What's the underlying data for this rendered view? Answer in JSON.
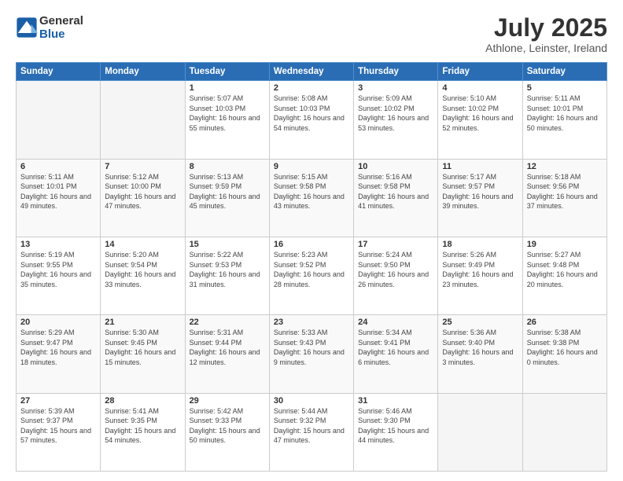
{
  "header": {
    "logo_general": "General",
    "logo_blue": "Blue",
    "month_year": "July 2025",
    "location": "Athlone, Leinster, Ireland"
  },
  "days_of_week": [
    "Sunday",
    "Monday",
    "Tuesday",
    "Wednesday",
    "Thursday",
    "Friday",
    "Saturday"
  ],
  "weeks": [
    [
      {
        "day": "",
        "empty": true
      },
      {
        "day": "",
        "empty": true
      },
      {
        "day": "1",
        "sunrise": "Sunrise: 5:07 AM",
        "sunset": "Sunset: 10:03 PM",
        "daylight": "Daylight: 16 hours and 55 minutes."
      },
      {
        "day": "2",
        "sunrise": "Sunrise: 5:08 AM",
        "sunset": "Sunset: 10:03 PM",
        "daylight": "Daylight: 16 hours and 54 minutes."
      },
      {
        "day": "3",
        "sunrise": "Sunrise: 5:09 AM",
        "sunset": "Sunset: 10:02 PM",
        "daylight": "Daylight: 16 hours and 53 minutes."
      },
      {
        "day": "4",
        "sunrise": "Sunrise: 5:10 AM",
        "sunset": "Sunset: 10:02 PM",
        "daylight": "Daylight: 16 hours and 52 minutes."
      },
      {
        "day": "5",
        "sunrise": "Sunrise: 5:11 AM",
        "sunset": "Sunset: 10:01 PM",
        "daylight": "Daylight: 16 hours and 50 minutes."
      }
    ],
    [
      {
        "day": "6",
        "sunrise": "Sunrise: 5:11 AM",
        "sunset": "Sunset: 10:01 PM",
        "daylight": "Daylight: 16 hours and 49 minutes."
      },
      {
        "day": "7",
        "sunrise": "Sunrise: 5:12 AM",
        "sunset": "Sunset: 10:00 PM",
        "daylight": "Daylight: 16 hours and 47 minutes."
      },
      {
        "day": "8",
        "sunrise": "Sunrise: 5:13 AM",
        "sunset": "Sunset: 9:59 PM",
        "daylight": "Daylight: 16 hours and 45 minutes."
      },
      {
        "day": "9",
        "sunrise": "Sunrise: 5:15 AM",
        "sunset": "Sunset: 9:58 PM",
        "daylight": "Daylight: 16 hours and 43 minutes."
      },
      {
        "day": "10",
        "sunrise": "Sunrise: 5:16 AM",
        "sunset": "Sunset: 9:58 PM",
        "daylight": "Daylight: 16 hours and 41 minutes."
      },
      {
        "day": "11",
        "sunrise": "Sunrise: 5:17 AM",
        "sunset": "Sunset: 9:57 PM",
        "daylight": "Daylight: 16 hours and 39 minutes."
      },
      {
        "day": "12",
        "sunrise": "Sunrise: 5:18 AM",
        "sunset": "Sunset: 9:56 PM",
        "daylight": "Daylight: 16 hours and 37 minutes."
      }
    ],
    [
      {
        "day": "13",
        "sunrise": "Sunrise: 5:19 AM",
        "sunset": "Sunset: 9:55 PM",
        "daylight": "Daylight: 16 hours and 35 minutes."
      },
      {
        "day": "14",
        "sunrise": "Sunrise: 5:20 AM",
        "sunset": "Sunset: 9:54 PM",
        "daylight": "Daylight: 16 hours and 33 minutes."
      },
      {
        "day": "15",
        "sunrise": "Sunrise: 5:22 AM",
        "sunset": "Sunset: 9:53 PM",
        "daylight": "Daylight: 16 hours and 31 minutes."
      },
      {
        "day": "16",
        "sunrise": "Sunrise: 5:23 AM",
        "sunset": "Sunset: 9:52 PM",
        "daylight": "Daylight: 16 hours and 28 minutes."
      },
      {
        "day": "17",
        "sunrise": "Sunrise: 5:24 AM",
        "sunset": "Sunset: 9:50 PM",
        "daylight": "Daylight: 16 hours and 26 minutes."
      },
      {
        "day": "18",
        "sunrise": "Sunrise: 5:26 AM",
        "sunset": "Sunset: 9:49 PM",
        "daylight": "Daylight: 16 hours and 23 minutes."
      },
      {
        "day": "19",
        "sunrise": "Sunrise: 5:27 AM",
        "sunset": "Sunset: 9:48 PM",
        "daylight": "Daylight: 16 hours and 20 minutes."
      }
    ],
    [
      {
        "day": "20",
        "sunrise": "Sunrise: 5:29 AM",
        "sunset": "Sunset: 9:47 PM",
        "daylight": "Daylight: 16 hours and 18 minutes."
      },
      {
        "day": "21",
        "sunrise": "Sunrise: 5:30 AM",
        "sunset": "Sunset: 9:45 PM",
        "daylight": "Daylight: 16 hours and 15 minutes."
      },
      {
        "day": "22",
        "sunrise": "Sunrise: 5:31 AM",
        "sunset": "Sunset: 9:44 PM",
        "daylight": "Daylight: 16 hours and 12 minutes."
      },
      {
        "day": "23",
        "sunrise": "Sunrise: 5:33 AM",
        "sunset": "Sunset: 9:43 PM",
        "daylight": "Daylight: 16 hours and 9 minutes."
      },
      {
        "day": "24",
        "sunrise": "Sunrise: 5:34 AM",
        "sunset": "Sunset: 9:41 PM",
        "daylight": "Daylight: 16 hours and 6 minutes."
      },
      {
        "day": "25",
        "sunrise": "Sunrise: 5:36 AM",
        "sunset": "Sunset: 9:40 PM",
        "daylight": "Daylight: 16 hours and 3 minutes."
      },
      {
        "day": "26",
        "sunrise": "Sunrise: 5:38 AM",
        "sunset": "Sunset: 9:38 PM",
        "daylight": "Daylight: 16 hours and 0 minutes."
      }
    ],
    [
      {
        "day": "27",
        "sunrise": "Sunrise: 5:39 AM",
        "sunset": "Sunset: 9:37 PM",
        "daylight": "Daylight: 15 hours and 57 minutes."
      },
      {
        "day": "28",
        "sunrise": "Sunrise: 5:41 AM",
        "sunset": "Sunset: 9:35 PM",
        "daylight": "Daylight: 15 hours and 54 minutes."
      },
      {
        "day": "29",
        "sunrise": "Sunrise: 5:42 AM",
        "sunset": "Sunset: 9:33 PM",
        "daylight": "Daylight: 15 hours and 50 minutes."
      },
      {
        "day": "30",
        "sunrise": "Sunrise: 5:44 AM",
        "sunset": "Sunset: 9:32 PM",
        "daylight": "Daylight: 15 hours and 47 minutes."
      },
      {
        "day": "31",
        "sunrise": "Sunrise: 5:46 AM",
        "sunset": "Sunset: 9:30 PM",
        "daylight": "Daylight: 15 hours and 44 minutes."
      },
      {
        "day": "",
        "empty": true
      },
      {
        "day": "",
        "empty": true
      }
    ]
  ]
}
